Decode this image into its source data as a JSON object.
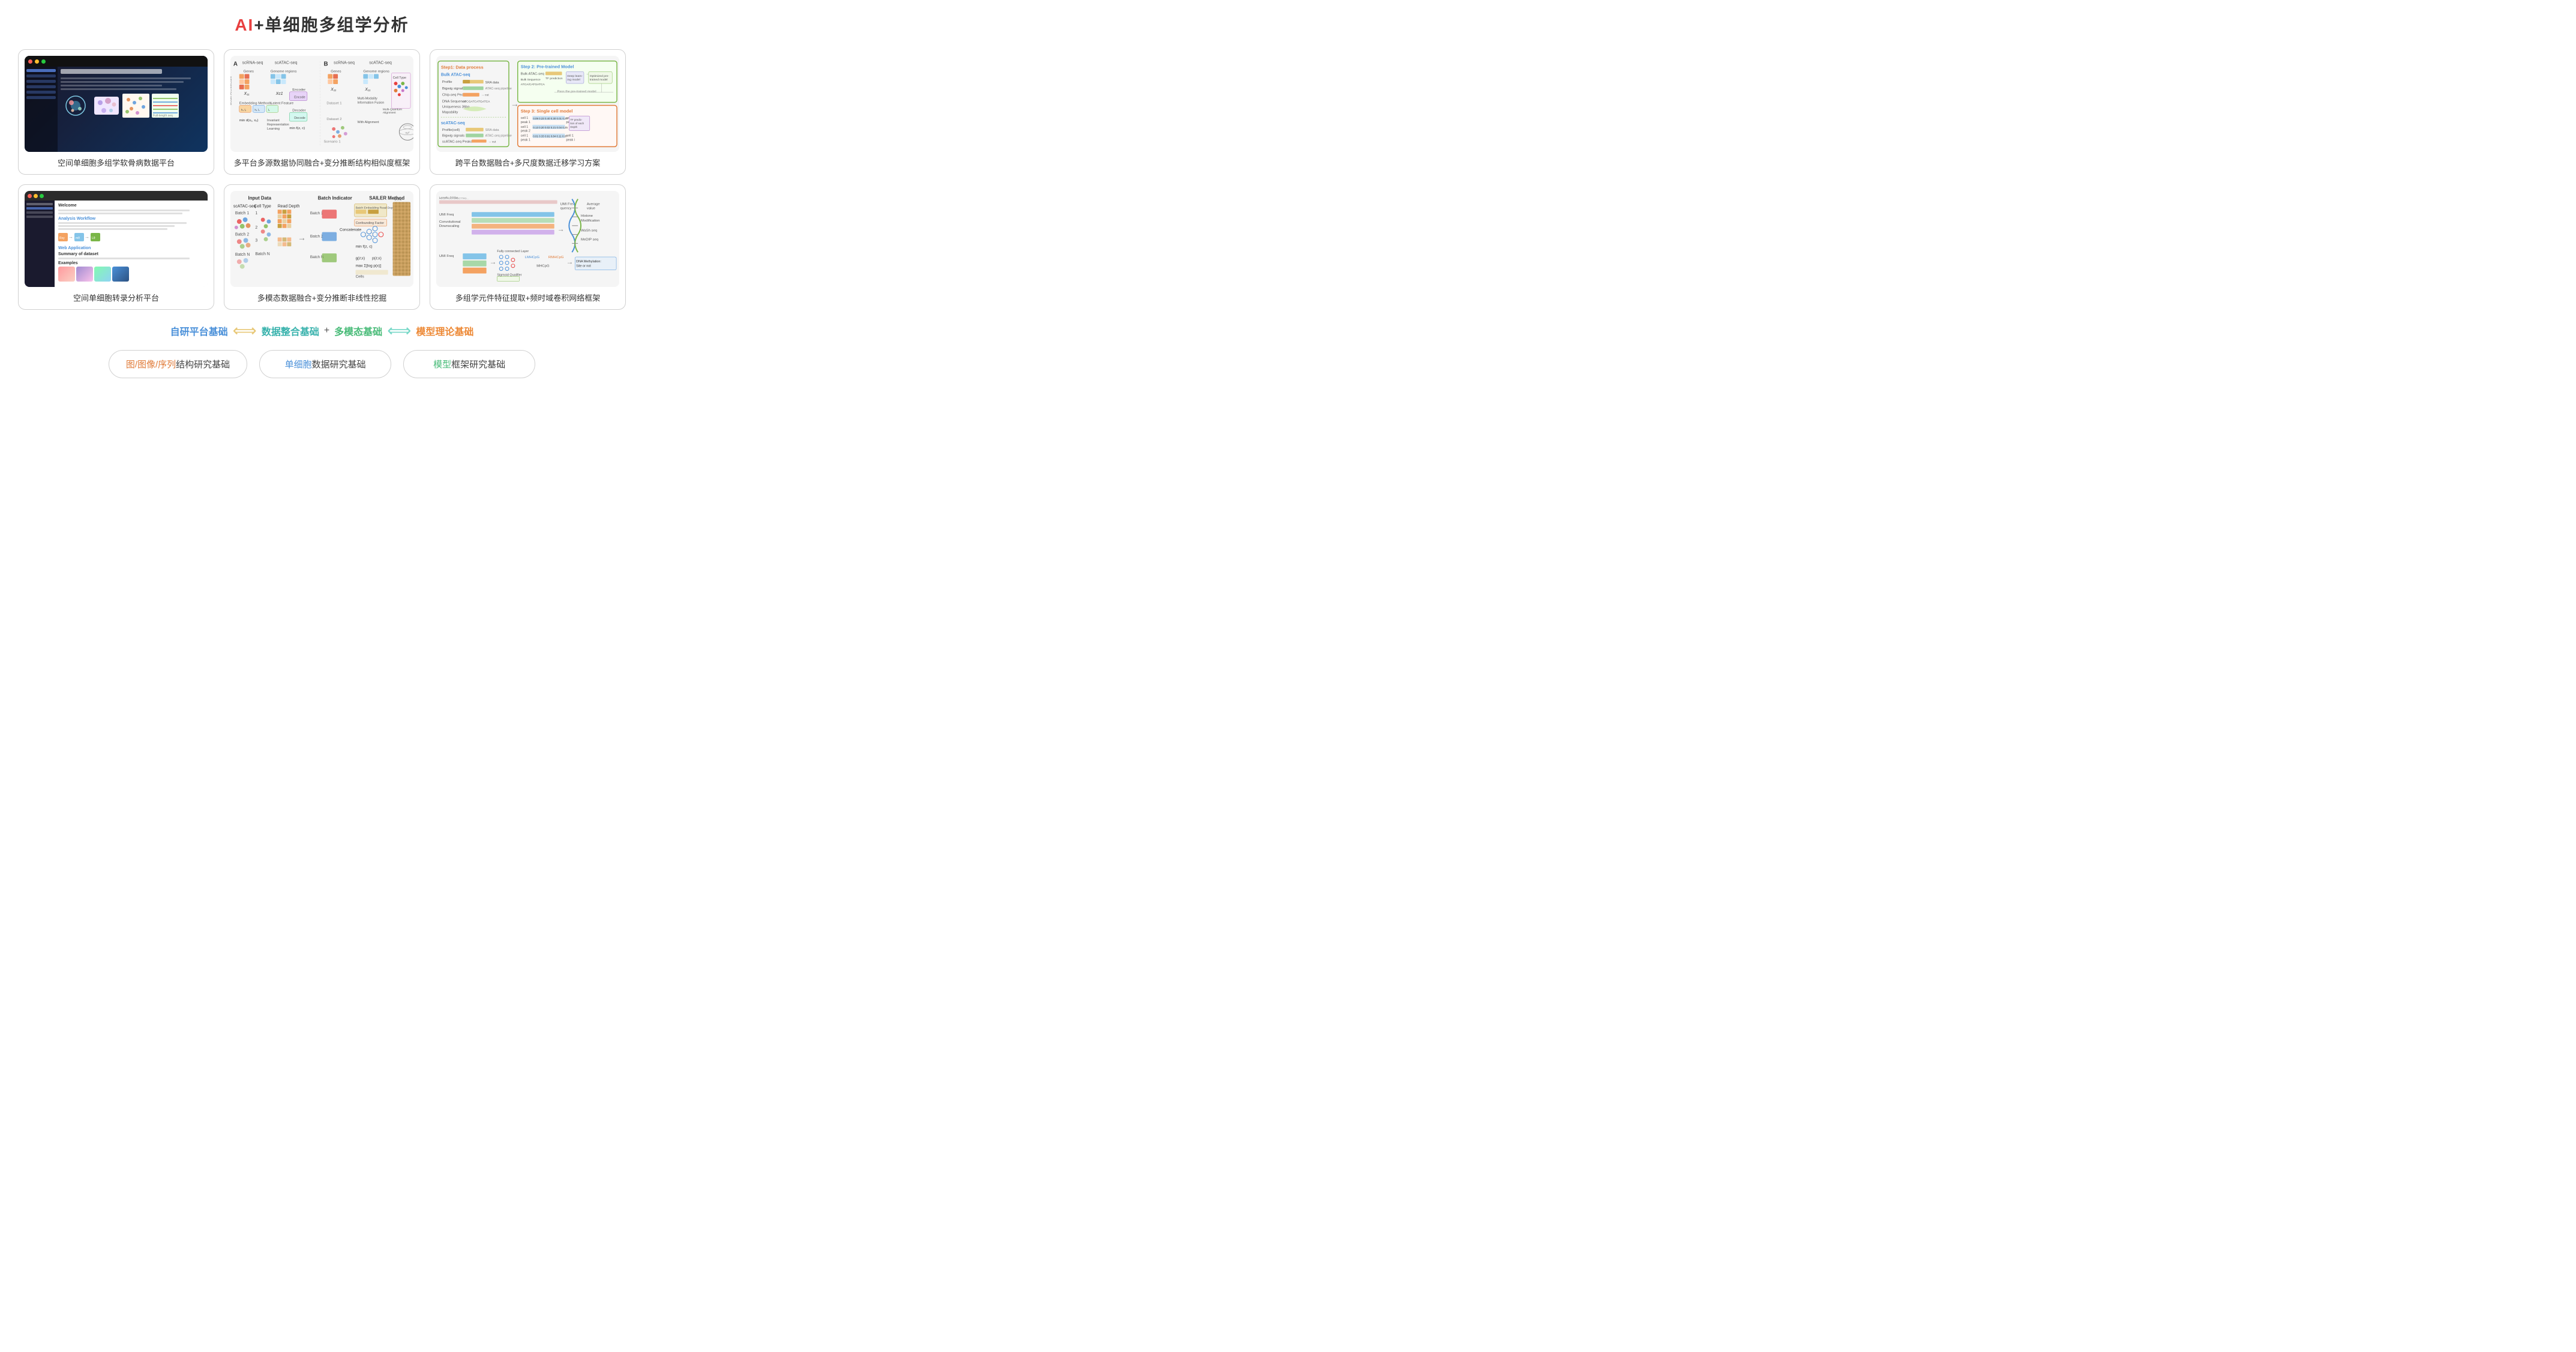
{
  "page": {
    "title_prefix": "AI",
    "title_suffix": "+单细胞多组学分析"
  },
  "cards": [
    {
      "id": "card1",
      "label": "空间单细胞多组学软骨病数据平台",
      "type": "dark-ui"
    },
    {
      "id": "card2",
      "label": "多平台多源数据协同融合+变分推断结构相似度框架",
      "type": "diagram",
      "section_a": "A",
      "section_b": "B",
      "top_label_left": "scRNA-seq",
      "top_label_mid": "scATAC-seq",
      "top_label_right_scrna": "scRNA-seq",
      "top_label_right_satac": "scATAC-seq",
      "genes_label": "Genes",
      "genome_label": "Genome regions",
      "embedding_label": "Embedding Methods",
      "encoder_label": "Encoder",
      "decoder_label": "Decoder",
      "latent_label": "Latent Feature",
      "invariant_label": "Invariant Representation Learning",
      "fusion_label": "Multi-Modality Information Fusion",
      "min_formula": "min d(x₁, x₂)",
      "min_formula2": "min f(z, c)"
    },
    {
      "id": "card3",
      "label": "跨平台数据融合+多尺度数据迁移学习方案",
      "type": "pipeline",
      "step1_title": "Step1: Data process",
      "step2_title": "Step 2: Pre-trained Model",
      "step3_title": "Step 3: Single cell model",
      "bulk_atac_label": "Bulk ATAC-seq",
      "scatac_label": "scATAC-seq",
      "sra_label": "SRA data",
      "pipeline_label": "ATAC-seq pipeline",
      "deep_learning": "Deep learning model",
      "optimized": "Optimized pre-trained model",
      "profile_label": "Profile",
      "bigwig_label": "Bigwig signals",
      "chip_seq": "Chip-seq Peaks",
      "dna_seq": "DNA Sequence",
      "uniqueness": "Uniqueness 36bp",
      "mapability": "Mapability"
    },
    {
      "id": "card4",
      "label": "空间单细胞转录分析平台",
      "type": "web-ui"
    },
    {
      "id": "card5",
      "label": "多模态数据融合+变分推断非线性挖掘",
      "type": "sailer",
      "input_data": "Input Data",
      "batch_indicator": "Batch Indicator",
      "sailer_method": "SAILER Method",
      "scatac_seq": "scATAC-seq",
      "batch1": "Batch 1",
      "batch2": "Batch 2",
      "batch_n": "Batch N",
      "read_depth": "Read Depth",
      "cells_label": "Cells",
      "cell_type": "Cell Type",
      "concatenate": "Concatenate",
      "batch_embed": "Batch Embedding Read Depth",
      "confounding": "Confounding Factor",
      "min_fzc": "min f(z, c)",
      "gze": "g(z;ε)",
      "pze": "p(z;ε)",
      "max_formula": "max Σ[log p(x)]"
    },
    {
      "id": "card6",
      "label": "多组学元件特征提取+频时域卷积网络框架",
      "type": "network"
    }
  ],
  "foundation": {
    "self_built": "自研平台基础",
    "data_integration": "数据整合基础",
    "multimodal": "多模态基础",
    "model_theory": "模型理论基础",
    "plus": "+"
  },
  "research_basis": [
    {
      "id": "basis1",
      "text_parts": [
        {
          "text": "图/图像/序列",
          "color": "orange"
        },
        {
          "text": "结构研究基础",
          "color": "normal"
        }
      ],
      "full_text": "图/图像/序列结构研究基础"
    },
    {
      "id": "basis2",
      "text_parts": [
        {
          "text": "单细胞",
          "color": "blue"
        },
        {
          "text": "数据研究基础",
          "color": "normal"
        }
      ],
      "full_text": "单细胞数据研究基础"
    },
    {
      "id": "basis3",
      "text_parts": [
        {
          "text": "模型",
          "color": "green"
        },
        {
          "text": "框架研究基础",
          "color": "normal"
        }
      ],
      "full_text": "模型框架研究基础"
    }
  ]
}
